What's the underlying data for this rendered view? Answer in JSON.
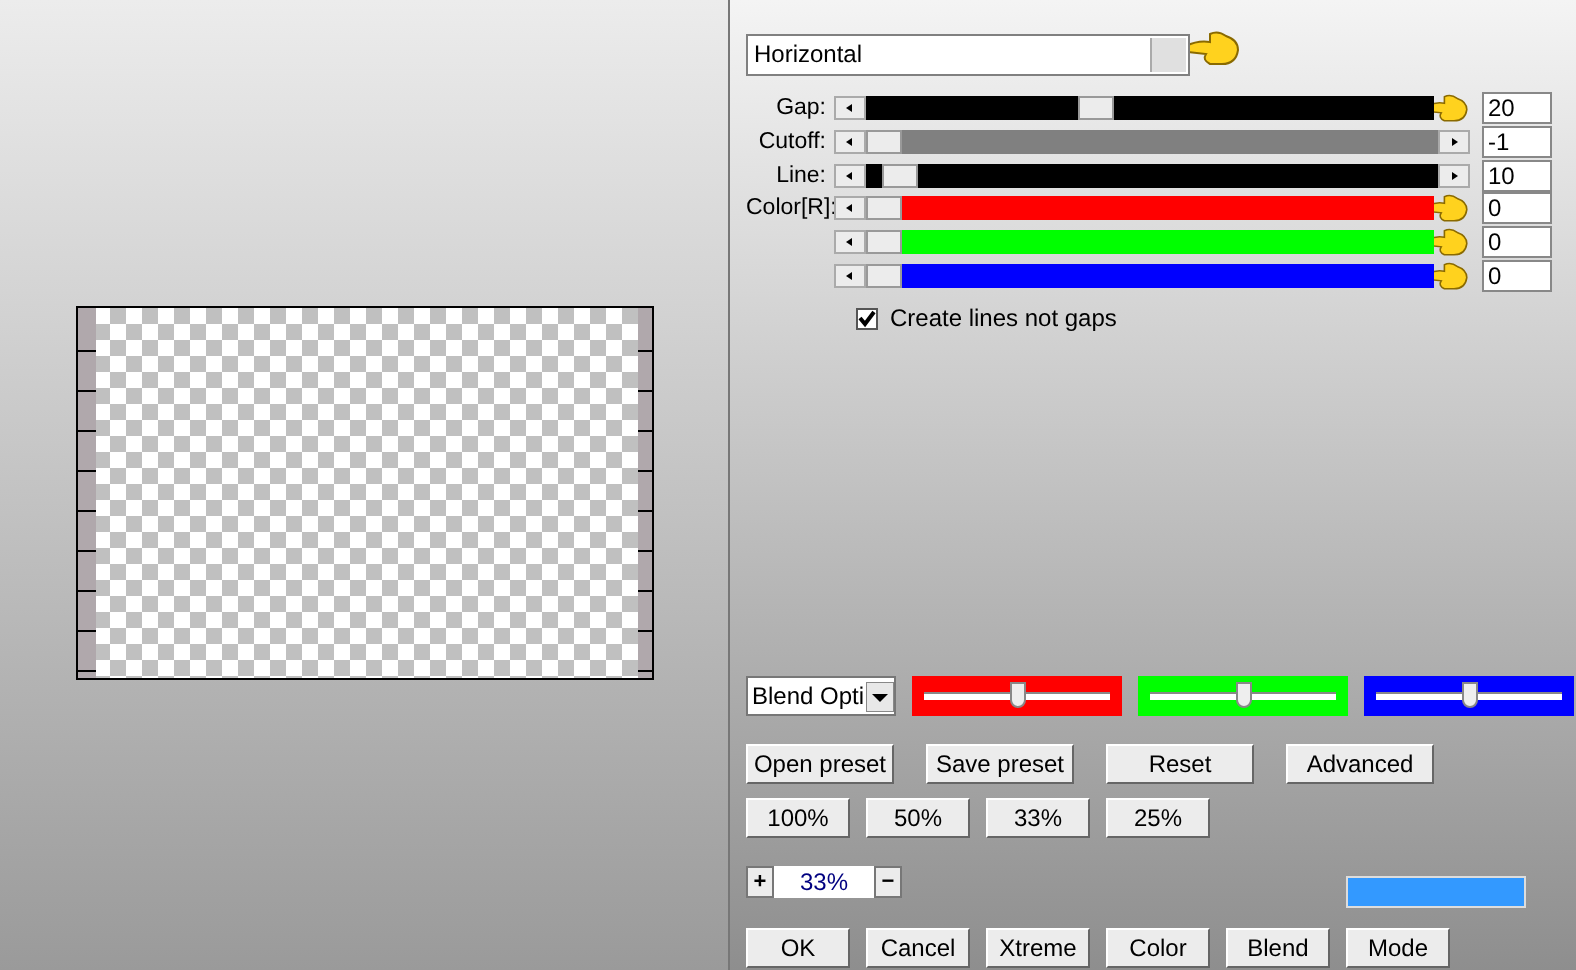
{
  "dropdown": {
    "value": "Horizontal",
    "pointer": true
  },
  "sliders": [
    {
      "label": "Gap:",
      "color": "#000000",
      "level": 0.4,
      "value": "20",
      "pointer": true
    },
    {
      "label": "Cutoff:",
      "color": "#808080",
      "level": 0,
      "value": "-1",
      "pointer": false
    },
    {
      "label": "Line:",
      "color": "#000000",
      "level": 0.03,
      "value": "10",
      "pointer": false
    },
    {
      "label": "Color[R]:",
      "color": "#ff0000",
      "level": 0,
      "value": "0",
      "pointer": true
    },
    {
      "color": "#00ff00",
      "level": 0,
      "value": "0",
      "pointer": true
    },
    {
      "color": "#0000ff",
      "level": 0,
      "value": "0",
      "pointer": true
    }
  ],
  "checkbox": {
    "label": "Create lines not gaps",
    "checked": true
  },
  "blend_select": {
    "value": "Blend Opti"
  },
  "color_sliders": [
    {
      "color": "#ff0000",
      "level": 0.5
    },
    {
      "color": "#00ff00",
      "level": 0.5
    },
    {
      "color": "#0000ff",
      "level": 0.5
    }
  ],
  "preset_buttons": [
    "Open preset",
    "Save preset",
    "Reset",
    "Advanced"
  ],
  "zoom_buttons": [
    "100%",
    "50%",
    "33%",
    "25%"
  ],
  "zoom": {
    "plus": "+",
    "value": "33%",
    "minus": "−"
  },
  "swatch": {
    "color": "#3399ff"
  },
  "bottom_buttons": [
    "OK",
    "Cancel",
    "Xtreme",
    "Color",
    "Blend",
    "Mode"
  ]
}
